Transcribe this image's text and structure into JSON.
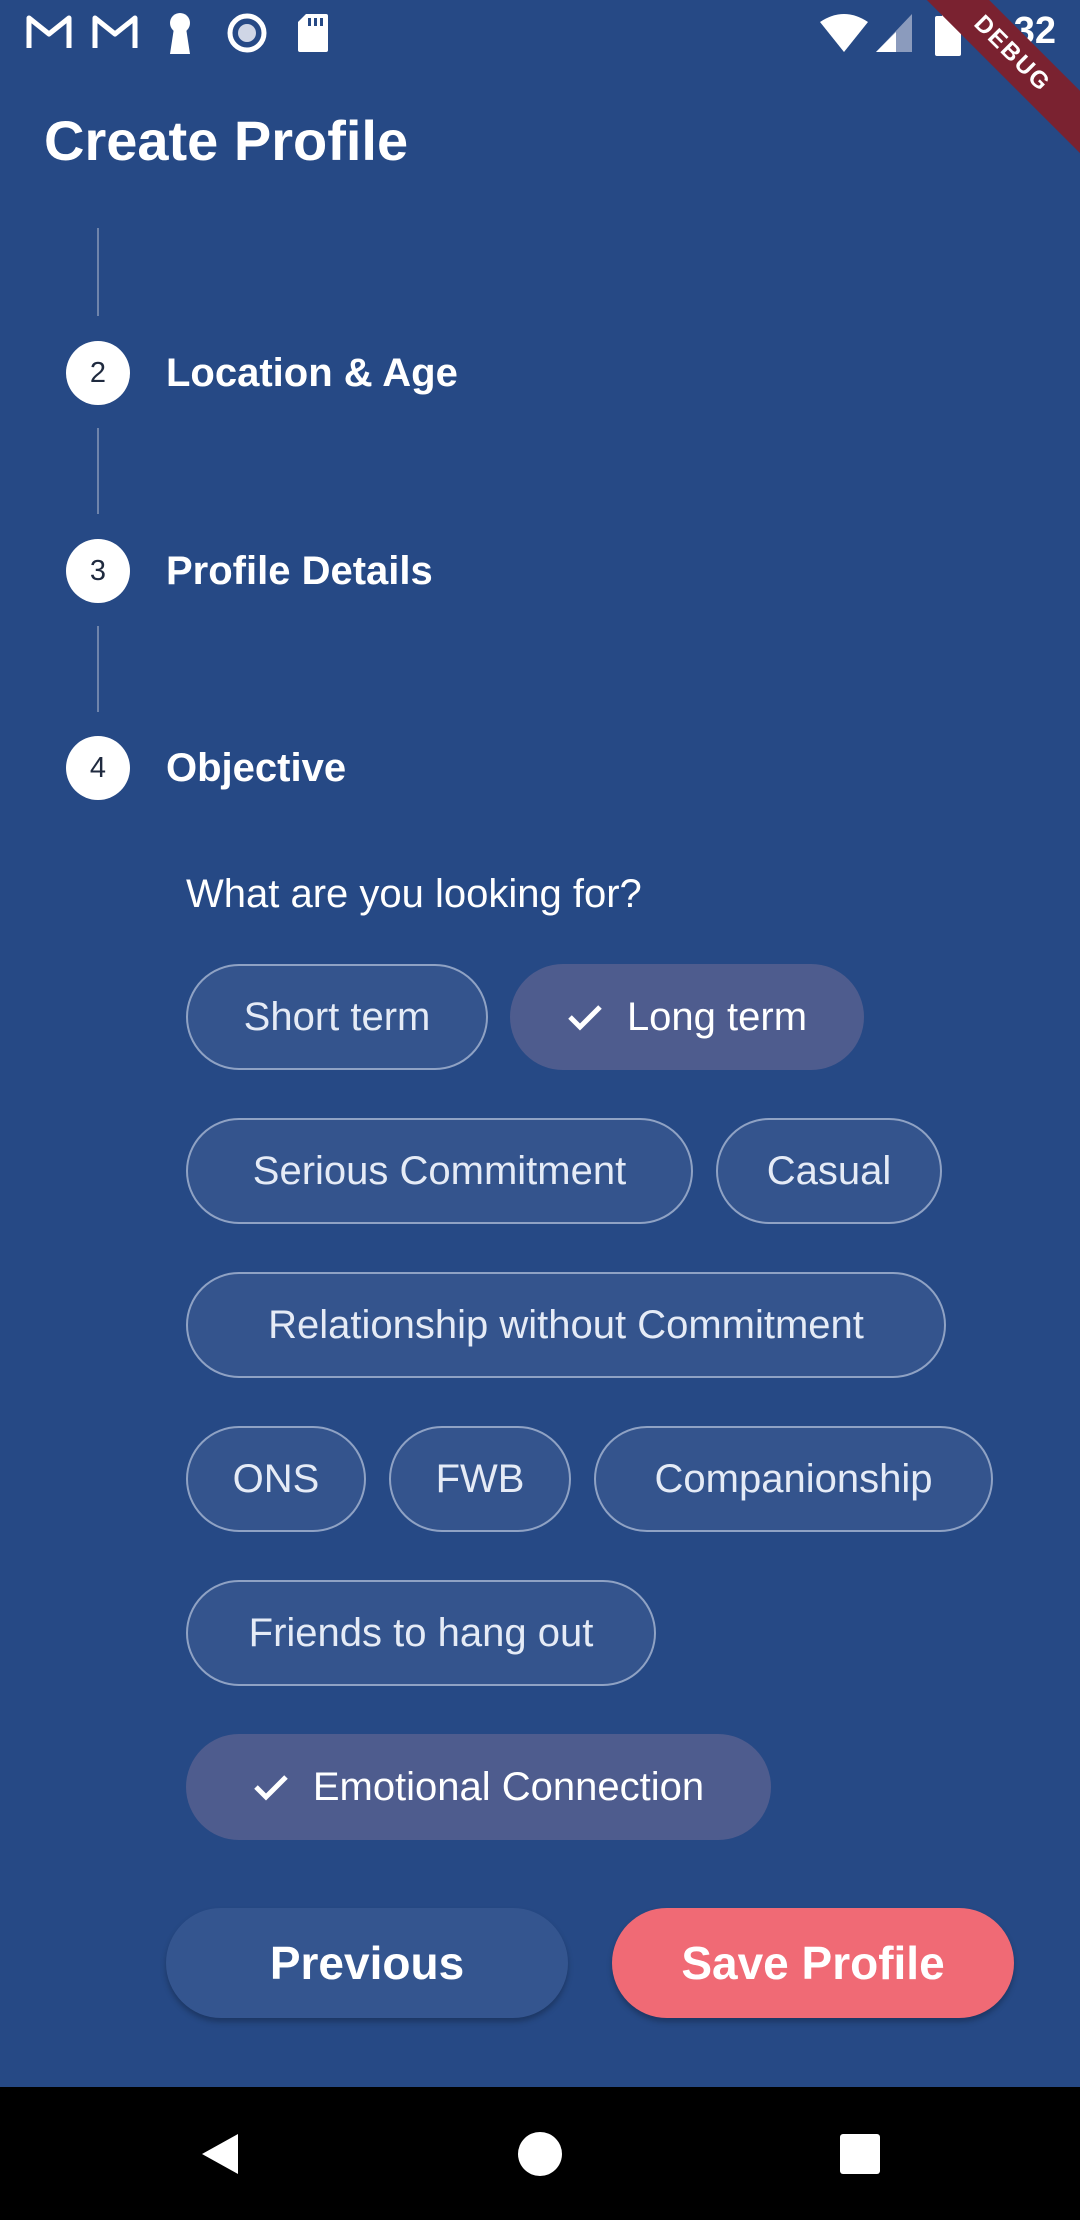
{
  "status_bar": {
    "time": "1:32",
    "debug_label": "DEBUG",
    "icons": [
      "gmail-icon",
      "gmail-icon",
      "keyhole-icon",
      "record-icon",
      "sd-card-icon",
      "wifi-icon",
      "cell-signal-icon",
      "battery-icon"
    ]
  },
  "header": {
    "title": "Create Profile"
  },
  "steps": [
    {
      "number": "2",
      "label": "Location & Age"
    },
    {
      "number": "3",
      "label": "Profile Details"
    },
    {
      "number": "4",
      "label": "Objective"
    }
  ],
  "objective": {
    "question": "What are you looking for?",
    "chips": [
      {
        "label": "Short term",
        "selected": false
      },
      {
        "label": "Long term",
        "selected": true
      },
      {
        "label": "Serious Commitment",
        "selected": false
      },
      {
        "label": "Casual",
        "selected": false
      },
      {
        "label": "Relationship without Commitment",
        "selected": false
      },
      {
        "label": "ONS",
        "selected": false
      },
      {
        "label": "FWB",
        "selected": false
      },
      {
        "label": "Companionship",
        "selected": false
      },
      {
        "label": "Friends to hang out",
        "selected": false
      },
      {
        "label": "Emotional Connection",
        "selected": true
      }
    ]
  },
  "actions": {
    "previous_label": "Previous",
    "save_label": "Save Profile"
  },
  "nav_bar": {
    "icons": [
      "back-icon",
      "home-icon",
      "recents-icon"
    ]
  },
  "colors": {
    "background": "#264985",
    "chip_selected": "#4e5c8e",
    "save_button": "#f06a75"
  }
}
